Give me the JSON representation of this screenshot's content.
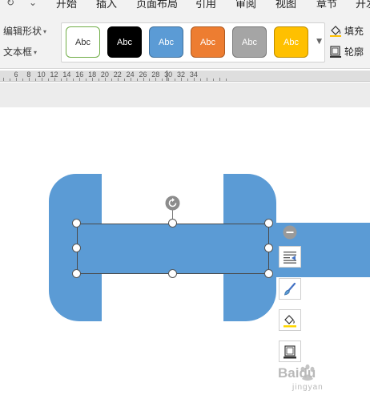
{
  "menubar": {
    "items": [
      "开始",
      "插入",
      "页面布局",
      "引用",
      "审阅",
      "视图",
      "章节",
      "开发"
    ]
  },
  "ribbon": {
    "edit_shape_label": "编辑形状",
    "textbox_label": "文本框",
    "style_gallery": [
      {
        "label": "Abc",
        "fill": "#ffffff",
        "border": "#70ad47",
        "text": "#333333"
      },
      {
        "label": "Abc",
        "fill": "#000000",
        "border": "#000000",
        "text": "#ffffff"
      },
      {
        "label": "Abc",
        "fill": "#5b9bd5",
        "border": "#41719c",
        "text": "#ffffff"
      },
      {
        "label": "Abc",
        "fill": "#ed7d31",
        "border": "#ae5a21",
        "text": "#ffffff"
      },
      {
        "label": "Abc",
        "fill": "#a5a5a5",
        "border": "#787878",
        "text": "#ffffff"
      },
      {
        "label": "Abc",
        "fill": "#ffc000",
        "border": "#bc8c00",
        "text": "#ffffff"
      }
    ],
    "fill_label": "填充",
    "outline_label": "轮廓"
  },
  "ruler": {
    "labels": [
      "6",
      "8",
      "10",
      "12",
      "14",
      "16",
      "18",
      "20",
      "22",
      "24",
      "26",
      "28",
      "30",
      "32",
      "34"
    ]
  },
  "canvas": {
    "shape_color": "#5b9bd5"
  },
  "watermark": {
    "brand": "Baidu",
    "sub": "jingyan"
  }
}
